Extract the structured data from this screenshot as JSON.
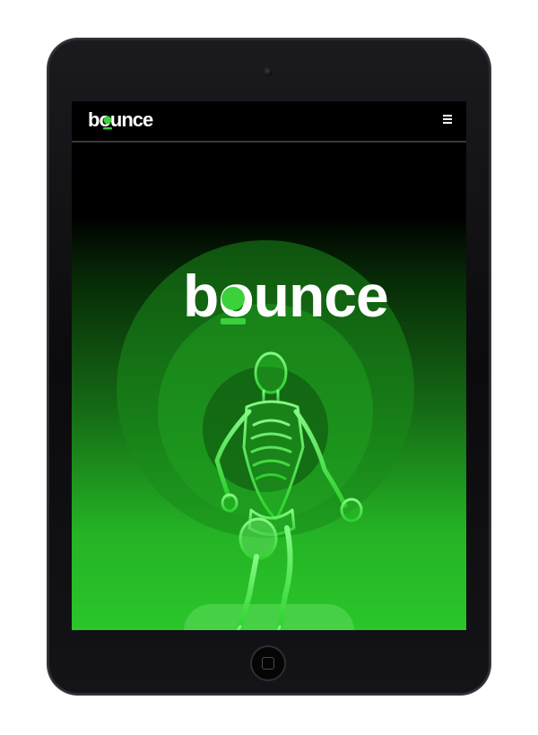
{
  "brand": {
    "name": "bounce",
    "accent_color": "#3ad13a",
    "background_color": "#000000"
  },
  "navbar": {
    "logo_text": "bounce",
    "menu_icon": "hamburger-menu-icon"
  },
  "hero": {
    "logo_text": "bounce",
    "image": "x-ray-running-man-illustration"
  },
  "device": {
    "type": "tablet",
    "home_button_icon": "home-button"
  }
}
